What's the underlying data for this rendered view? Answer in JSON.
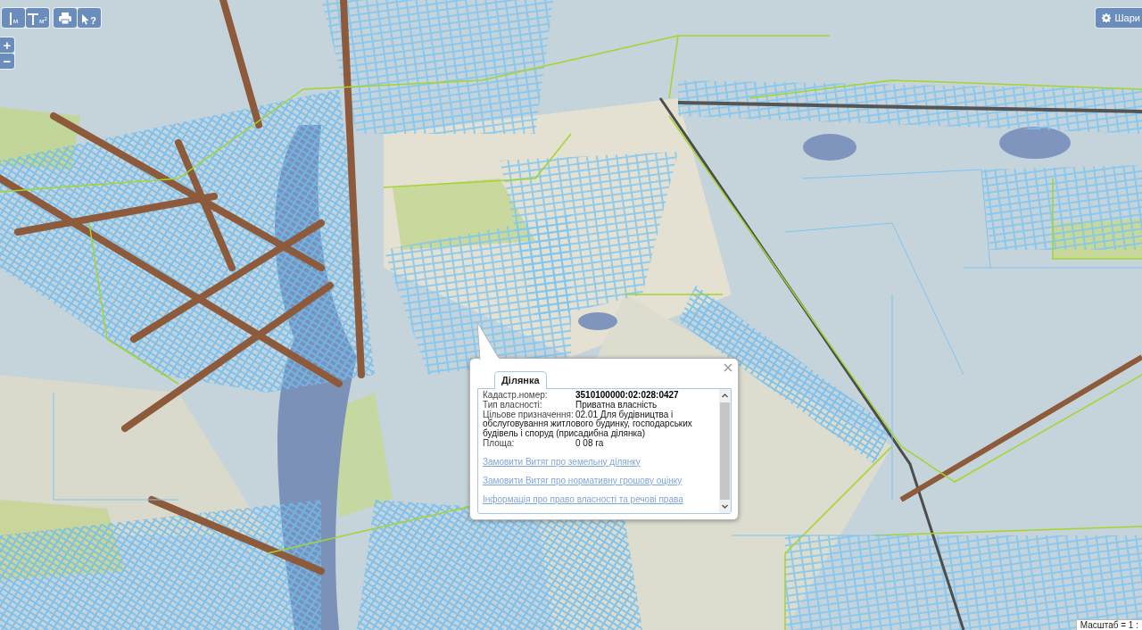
{
  "toolbar": [
    [
      {
        "kind": "distance",
        "unit": "м"
      },
      {
        "kind": "area",
        "unit": "м$^{2}$"
      }
    ],
    [
      {
        "kind": "print"
      },
      {
        "kind": "identify",
        "label": "?"
      }
    ]
  ],
  "zoom_controls": [
    "+",
    "−"
  ],
  "layers_button": {
    "label": "Шари"
  },
  "popup": {
    "tabs": [
      {
        "label": "Ділянка",
        "selected": true
      }
    ],
    "fields": [
      {
        "label": "Кадастр.номер:",
        "value": "3510100000:02:028:0427",
        "bold": true
      },
      {
        "label": "Тип власності:",
        "value": "Приватна власність",
        "bold": false
      },
      {
        "label": "Цільове призначення:",
        "value": "02.01 Для будівництва і",
        "continuation": "обслуговування житлового будинку, господарських будівель і споруд (присадибна ділянка)",
        "bold": false
      },
      {
        "label": "Площа:",
        "value": "0 08 га",
        "bold": false
      }
    ],
    "links": [
      "Замовити Витяг про земельну ділянку",
      "Замовити Витяг про нормативну грошову оцінку",
      "Інформація про право власності та речові права"
    ]
  },
  "scale": "Масштаб = 1 :"
}
